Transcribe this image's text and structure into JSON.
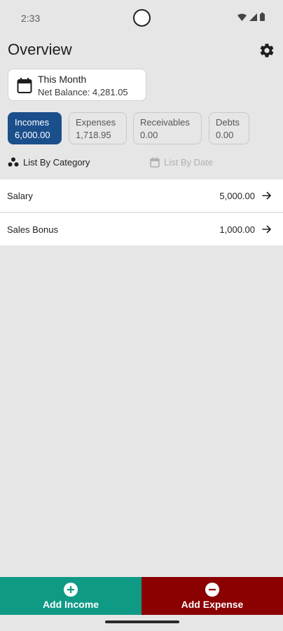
{
  "status": {
    "time": "2:33"
  },
  "header": {
    "title": "Overview"
  },
  "period": {
    "label": "This Month",
    "net_balance": "Net Balance: 4,281.05"
  },
  "tabs": [
    {
      "label": "Incomes",
      "value": "6,000.00",
      "active": true
    },
    {
      "label": "Expenses",
      "value": "1,718.95",
      "active": false
    },
    {
      "label": "Receivables",
      "value": "0.00",
      "active": false
    },
    {
      "label": "Debts",
      "value": "0.00",
      "active": false
    }
  ],
  "list_modes": {
    "by_category": "List By Category",
    "by_date": "List By Date",
    "selected": "by_category"
  },
  "categories": [
    {
      "name": "Salary",
      "amount": "5,000.00"
    },
    {
      "name": "Sales Bonus",
      "amount": "1,000.00"
    }
  ],
  "actions": {
    "add_income": "Add Income",
    "add_expense": "Add Expense"
  },
  "colors": {
    "active_tab": "#1b4f8c",
    "income_button": "#0f9a86",
    "expense_button": "#8b0000",
    "background": "#e6e6e6"
  },
  "icons": [
    "calendar-icon",
    "gear-icon",
    "category-icon",
    "date-icon",
    "arrow-right-icon",
    "plus-circle-icon",
    "minus-circle-icon",
    "wifi-icon",
    "signal-icon",
    "battery-icon"
  ]
}
